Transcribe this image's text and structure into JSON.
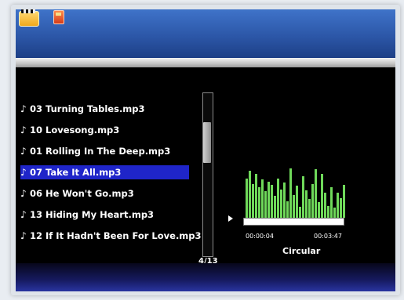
{
  "topbar": {
    "icons": [
      "video-folder-icon",
      "sd-card-icon"
    ],
    "title": ""
  },
  "playlist": {
    "items": [
      {
        "label": "03 Turning Tables.mp3",
        "icon": "music-note-icon",
        "selected": false
      },
      {
        "label": "10 Lovesong.mp3",
        "icon": "music-note-icon",
        "selected": false
      },
      {
        "label": "01 Rolling In The Deep.mp3",
        "icon": "music-note-icon",
        "selected": false
      },
      {
        "label": "07 Take It All.mp3",
        "icon": "music-note-icon",
        "selected": true
      },
      {
        "label": "06 He Won't Go.mp3",
        "icon": "music-note-icon",
        "selected": false
      },
      {
        "label": "13 Hiding My Heart.mp3",
        "icon": "music-note-icon",
        "selected": false
      },
      {
        "label": "12 If It Hadn't Been For Love.mp3",
        "icon": "music-note-icon",
        "selected": false
      }
    ],
    "page_indicator": "4/13"
  },
  "player": {
    "elapsed": "00:00:04",
    "total": "00:03:47",
    "progress": 0.02,
    "mode": "Circular",
    "spectrum": [
      0.72,
      0.85,
      0.62,
      0.8,
      0.55,
      0.7,
      0.48,
      0.66,
      0.6,
      0.4,
      0.72,
      0.52,
      0.64,
      0.3,
      0.9,
      0.42,
      0.58,
      0.2,
      0.76,
      0.5,
      0.34,
      0.62,
      0.88,
      0.28,
      0.8,
      0.45,
      0.22,
      0.56,
      0.18,
      0.46,
      0.36,
      0.6
    ],
    "colors": {
      "spectrum": "#6fd95a",
      "selection": "#1f25c9"
    }
  }
}
